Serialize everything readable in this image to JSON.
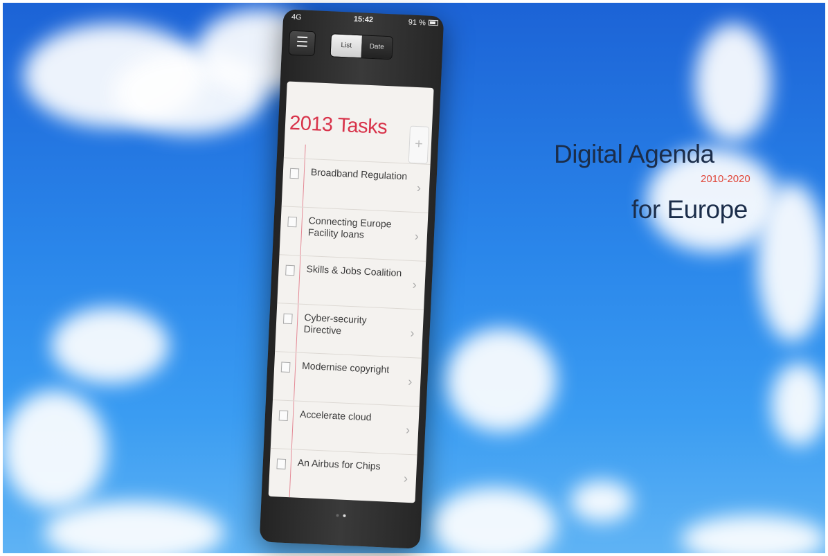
{
  "headline": {
    "line1": "Digital Agenda",
    "years": "2010-2020",
    "line2": "for Europe"
  },
  "phone": {
    "status": {
      "signal": "4G",
      "time": "15:42",
      "battery": "91 %"
    },
    "segments": [
      "List",
      "Date"
    ],
    "title": "2013 Tasks",
    "add_label": "+",
    "tasks": [
      "Broadband Regulation",
      "Connecting Europe Facility loans",
      "Skills & Jobs Coalition",
      "Cyber-security Directive",
      "Modernise copyright",
      "Accelerate cloud",
      "An Airbus for Chips"
    ]
  },
  "icons": {
    "menu": "hamburger-icon",
    "chevron": "chevron-right-icon",
    "checkbox": "checkbox-icon"
  },
  "colors": {
    "title_red": "#d8334a",
    "headline_navy": "#1b2d4a",
    "years_red": "#e0473a"
  }
}
